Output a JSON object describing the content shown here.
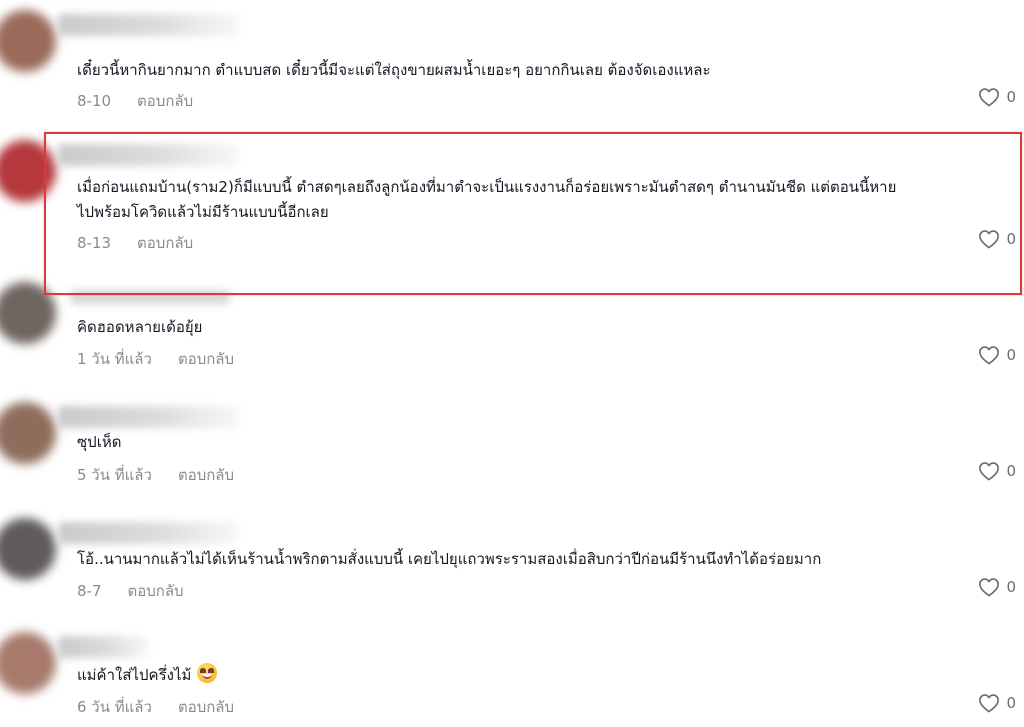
{
  "comments": [
    {
      "text": "เดี๋ยวนี้หากินยากมาก ตำแบบสด เดี๋ยวนี้มีจะแต่ใส่ถุงขายผสมน้ำเยอะๆ อยากกินเลย ต้องจัดเองแหละ",
      "time": "8-10",
      "reply": "ตอบกลับ",
      "likes": "0",
      "avatar_color": "#9a6a5a"
    },
    {
      "text_line1": "เมื่อก่อนแถมบ้าน(ราม2)ก็มีแบบนี้ ตำสดๆเลยถึงลูกน้องที่มาตำจะเป็นแรงงานก็อร่อยเพราะมันตำสดๆ ตำนานมันชีด แต่ตอนนี้หาย",
      "text_line2": "ไปพร้อมโควิดแล้วไม่มีร้านแบบนี้อีกเลย",
      "time": "8-13",
      "reply": "ตอบกลับ",
      "likes": "0",
      "avatar_color": "#b4383c",
      "highlighted": true,
      "highlight_color": "#d93a3a"
    },
    {
      "text": "คิดฮอดหลายเด้อยุ้ย",
      "time": "1 วัน ที่แล้ว",
      "reply": "ตอบกลับ",
      "likes": "0",
      "avatar_color": "#6f6660"
    },
    {
      "text": "ซุปเห็ด",
      "time": "5 วัน ที่แล้ว",
      "reply": "ตอบกลับ",
      "likes": "0",
      "avatar_color": "#8f6d5c"
    },
    {
      "text": "โอ้..นานมากแล้วไม่ได้เห็นร้านน้ำพริกตามสั่งแบบนี้ เคยไปยุแถวพระรามสองเมื่อสิบกว่าปีก่อนมีร้านนึงทำได้อร่อยมาก",
      "time": "8-7",
      "reply": "ตอบกลับ",
      "likes": "0",
      "avatar_color": "#5f5b5a"
    },
    {
      "text": "แม่ค้าใส่ไปครึ่งไม้",
      "emoji": "grinning-face-emoji",
      "time": "6 วัน ที่แล้ว",
      "reply": "ตอบกลับ",
      "likes": "0",
      "avatar_color": "#a77a6c"
    }
  ],
  "icons": {
    "like": "heart-outline-icon"
  },
  "colors": {
    "text": "#161823",
    "meta": "#8a8b91",
    "highlight": "#d93a3a"
  }
}
